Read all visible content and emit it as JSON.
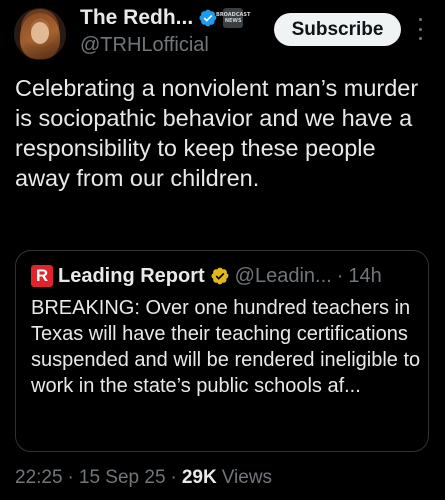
{
  "author": {
    "display_name": "The Redh...",
    "handle": "@TRHLofficial",
    "affiliate_badge_text": "BROADCAST NEWS"
  },
  "subscribe_label": "Subscribe",
  "tweet": {
    "text": "Celebrating a nonviolent man’s murder is sociopathic behavior and we have a responsibility to keep these people away from our children."
  },
  "quote": {
    "logo_letter": "R",
    "name": "Leading Report",
    "handle": "@Leadin...",
    "dot": "·",
    "time": "14h",
    "text": "BREAKING: Over one hundred teachers in Texas will have their teaching certifications suspended and will be rendered ineligible to work in the state’s public schools af..."
  },
  "meta": {
    "time": "22:25",
    "sep1": "·",
    "date": "15 Sep 25",
    "sep2": "·",
    "views_count": "29K",
    "views_label": "Views"
  },
  "colors": {
    "background": "#000000",
    "text": "#e7e9ea",
    "muted": "#71767b",
    "verified_blue": "#1d9bf0",
    "verified_gold": "#e2b719",
    "leading_report_red": "#e0242b",
    "border": "#2f3336"
  },
  "icons": {
    "verified": "verified-blue-check-icon",
    "quote_verified": "verified-gold-check-icon",
    "more": "more-vertical-icon"
  }
}
